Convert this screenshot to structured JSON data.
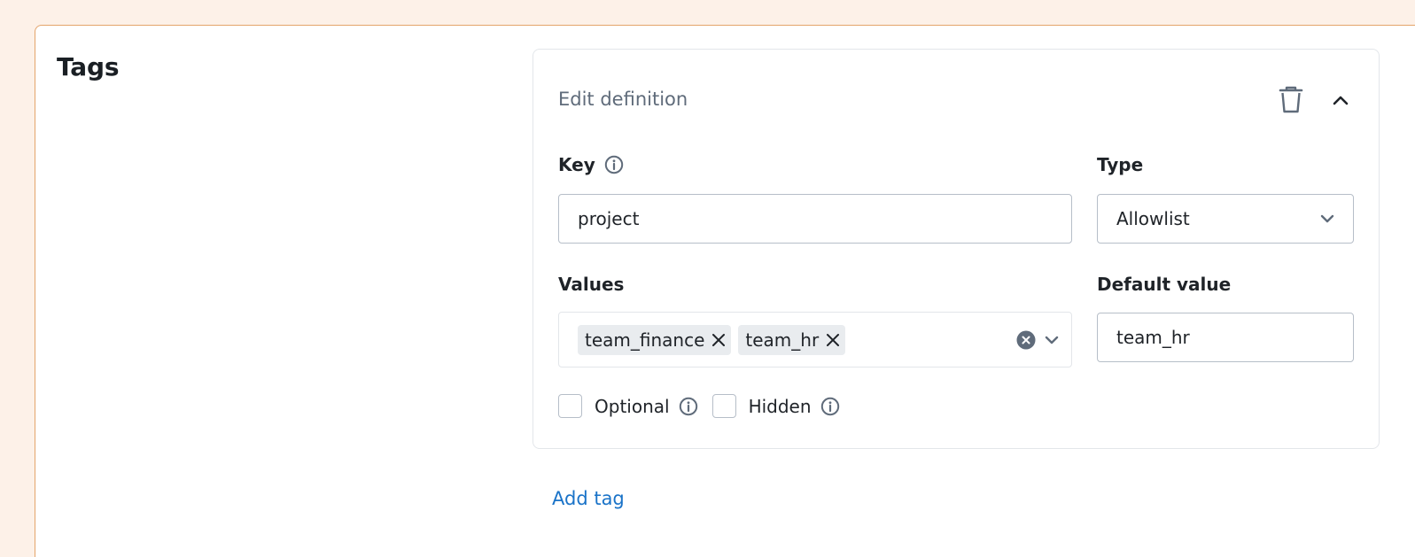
{
  "section": {
    "title": "Tags"
  },
  "definition": {
    "title": "Edit definition",
    "key": {
      "label": "Key",
      "value": "project",
      "info_icon": "info-icon"
    },
    "type": {
      "label": "Type",
      "selected": "Allowlist"
    },
    "values": {
      "label": "Values",
      "chips": [
        "team_finance",
        "team_hr"
      ]
    },
    "default_value": {
      "label": "Default value",
      "value": "team_hr"
    },
    "optional": {
      "label": "Optional",
      "checked": false
    },
    "hidden": {
      "label": "Hidden",
      "checked": false
    },
    "icons": {
      "delete": "trash-icon",
      "collapse": "chevron-up-icon"
    }
  },
  "actions": {
    "add_tag": "Add tag"
  },
  "colors": {
    "page_bg": "#fdf1e8",
    "panel_border": "#e5a56c",
    "link": "#1a73c8",
    "muted_text": "#5f6b7a",
    "chip_bg": "#e9ecef"
  }
}
